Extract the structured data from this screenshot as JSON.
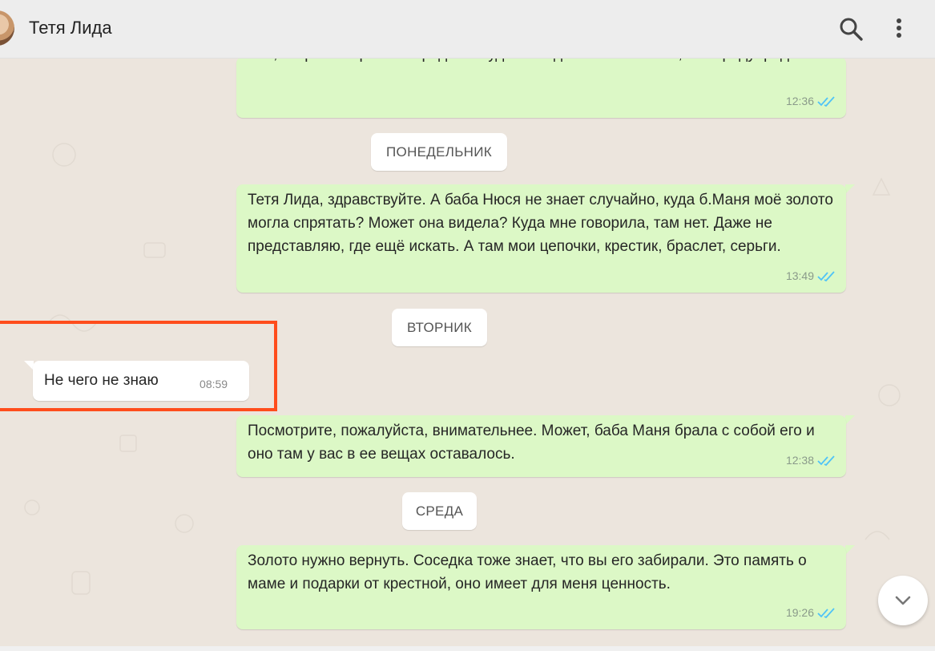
{
  "contact": {
    "name": "Тетя Лида"
  },
  "header_icons": [
    "search-icon",
    "kebab-menu-icon"
  ],
  "messages": [
    {
      "direction": "out",
      "text": "там, скоро собираюсь. Вроде он туда не ходит сам. Спасибо, что предупредили.",
      "time": "12:36",
      "status": "read"
    },
    {
      "type": "day",
      "label": "ПОНЕДЕЛЬНИК"
    },
    {
      "direction": "out",
      "text": "Тетя Лида, здравствуйте. А баба Нюся не знает случайно, куда б.Маня моё золото могла спрятать? Может она видела? Куда мне говорила, там нет. Даже не представляю, где ещё искать. А там мои цепочки, крестик, браслет, серьги.",
      "time": "13:49",
      "status": "read"
    },
    {
      "type": "day",
      "label": "ВТОРНИК"
    },
    {
      "direction": "in",
      "text": "Не чего не знаю",
      "time": "08:59"
    },
    {
      "direction": "out",
      "text": "Посмотрите, пожалуйста, внимательнее. Может, баба Маня брала с собой его и оно там у вас в ее вещах оставалось.",
      "time": "12:38",
      "status": "read"
    },
    {
      "type": "day",
      "label": "СРЕДА"
    },
    {
      "direction": "out",
      "text": "Золото нужно вернуть. Соседка тоже знает, что вы его забирали. Это память о маме и подарки от крестной, оно имеет для меня ценность.",
      "time": "19:26",
      "status": "read"
    }
  ],
  "colors": {
    "outgoing_bubble": "#dcf8c6",
    "incoming_bubble": "#ffffff",
    "read_tick": "#4fc3f7",
    "highlight_box": "#ff4d1c"
  },
  "scroll_down_icon": "chevron-down-icon"
}
